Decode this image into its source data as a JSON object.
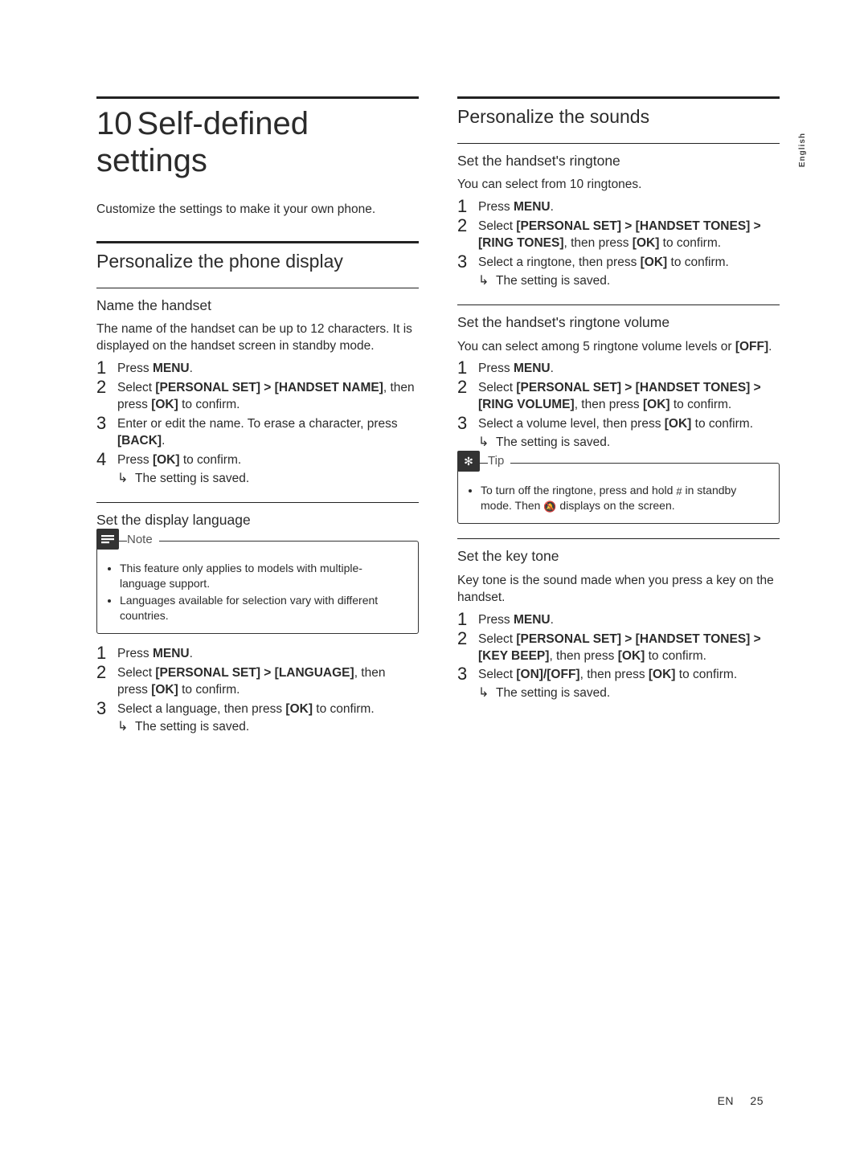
{
  "sideTab": "English",
  "chapter": {
    "num": "10",
    "title": "Self-defined settings"
  },
  "intro": "Customize the settings to make it your own phone.",
  "left": {
    "sectionTitle": "Personalize the phone display",
    "sub1": {
      "title": "Name the handset",
      "desc": "The name of the handset can be up to 12 characters. It is displayed on the handset screen in standby mode.",
      "s1pre": "Press ",
      "s1key": "MENU",
      "s1post": ".",
      "s2a": "Select ",
      "s2path": "[PERSONAL SET] > [HANDSET NAME]",
      "s2b": ", then press ",
      "s2key": "[OK]",
      "s2c": " to confirm.",
      "s3a": "Enter or edit the name. To erase a character, press ",
      "s3key": "[BACK]",
      "s3b": ".",
      "s4a": "Press ",
      "s4key": "[OK]",
      "s4b": " to confirm.",
      "result": "The setting is saved."
    },
    "sub2": {
      "title": "Set the display language",
      "noteLabel": "Note",
      "noteItems": [
        "This feature only applies to models with multiple-language support.",
        "Languages available for selection vary with different countries."
      ],
      "s1pre": "Press ",
      "s1key": "MENU",
      "s1post": ".",
      "s2a": "Select ",
      "s2path": "[PERSONAL SET] > [LANGUAGE]",
      "s2b": ", then press ",
      "s2key": "[OK]",
      "s2c": " to confirm.",
      "s3a": "Select a language, then press ",
      "s3key": "[OK]",
      "s3b": " to confirm.",
      "result": "The setting is saved."
    }
  },
  "right": {
    "sectionTitle": "Personalize the sounds",
    "sub1": {
      "title": "Set the handset's ringtone",
      "desc": "You can select from 10 ringtones.",
      "s1pre": "Press ",
      "s1key": "MENU",
      "s1post": ".",
      "s2a": "Select ",
      "s2path": "[PERSONAL SET] > [HANDSET TONES] > [RING TONES]",
      "s2b": ", then press ",
      "s2key": "[OK]",
      "s2c": " to confirm.",
      "s3a": "Select a ringtone, then press ",
      "s3key": "[OK]",
      "s3b": " to confirm.",
      "result": "The setting is saved."
    },
    "sub2": {
      "title": "Set the handset's ringtone volume",
      "desc_a": "You can select among 5 ringtone volume levels or ",
      "desc_key": "[OFF]",
      "desc_b": ".",
      "s1pre": "Press ",
      "s1key": "MENU",
      "s1post": ".",
      "s2a": "Select ",
      "s2path": "[PERSONAL SET] > [HANDSET TONES] > [RING VOLUME]",
      "s2b": ", then press ",
      "s2key": "[OK]",
      "s2c": " to confirm.",
      "s3a": "Select a volume level, then press ",
      "s3key": "[OK]",
      "s3b": " to confirm.",
      "result": "The setting is saved.",
      "tipLabel": "Tip",
      "tip_a": "To turn off the ringtone, press and hold ",
      "tip_b": " in standby mode. Then ",
      "tip_c": " displays on the screen."
    },
    "sub3": {
      "title": "Set the key tone",
      "desc": "Key tone is the sound made when you press a key on the handset.",
      "s1pre": "Press ",
      "s1key": "MENU",
      "s1post": ".",
      "s2a": "Select ",
      "s2path": "[PERSONAL SET] > [HANDSET TONES] > [KEY BEEP]",
      "s2b": ", then press ",
      "s2key": "[OK]",
      "s2c": " to confirm.",
      "s3a": "Select ",
      "s3path": "[ON]/[OFF]",
      "s3b": ", then press ",
      "s3key": "[OK]",
      "s3c": " to confirm.",
      "result": "The setting is saved."
    }
  },
  "footer": {
    "lang": "EN",
    "page": "25"
  }
}
